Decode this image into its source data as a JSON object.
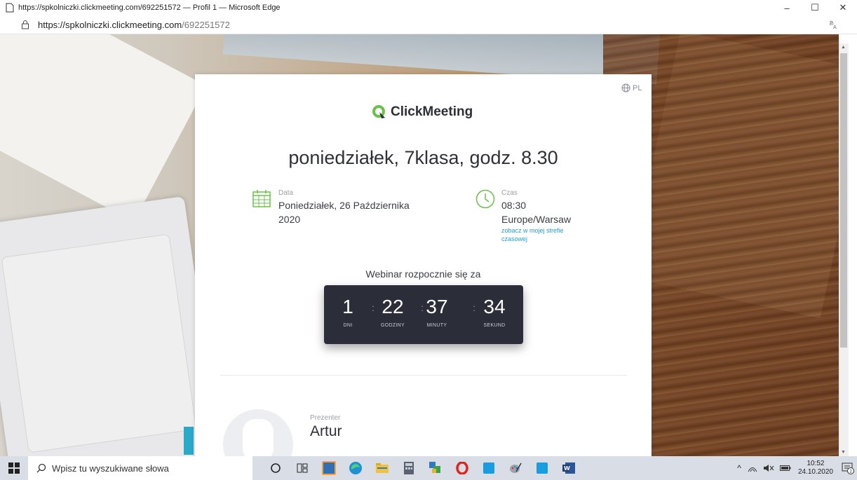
{
  "window": {
    "title": "https://spkolniczki.clickmeeting.com/692251572 — Profil 1 — Microsoft Edge",
    "controls": {
      "minimize": "–",
      "maximize": "☐",
      "close": "✕"
    }
  },
  "address_bar": {
    "url_host": "https://spkolniczki.clickmeeting.com",
    "url_path": "/692251572"
  },
  "page": {
    "language": "PL",
    "logo_text": "ClickMeeting",
    "event_title": "poniedziałek, 7klasa, godz. 8.30",
    "date": {
      "label": "Data",
      "value_line1": "Poniedziałek, 26 Października",
      "value_line2": "2020"
    },
    "time": {
      "label": "Czas",
      "value": "08:30",
      "timezone": "Europe/Warsaw",
      "link_line1": "zobacz w mojej strefie",
      "link_line2": "czasowej"
    },
    "countdown": {
      "label": "Webinar rozpocznie się za",
      "days": "1",
      "days_label": "DNI",
      "hours": "22",
      "hours_label": "GODZINY",
      "minutes": "37",
      "minutes_label": "MINUTY",
      "seconds": "34",
      "seconds_label": "SEKUND",
      "separator": ":"
    },
    "presenter": {
      "label": "Prezenter",
      "name": "Artur"
    }
  },
  "taskbar": {
    "search_placeholder": "Wpisz tu wyszukiwane słowa",
    "clock_time": "10:52",
    "clock_date": "24.10.2020",
    "notification_count": "2"
  },
  "colors": {
    "accent_green": "#6cc04a",
    "link_blue": "#1fa0d8",
    "countdown_bg": "#2b2e38"
  }
}
